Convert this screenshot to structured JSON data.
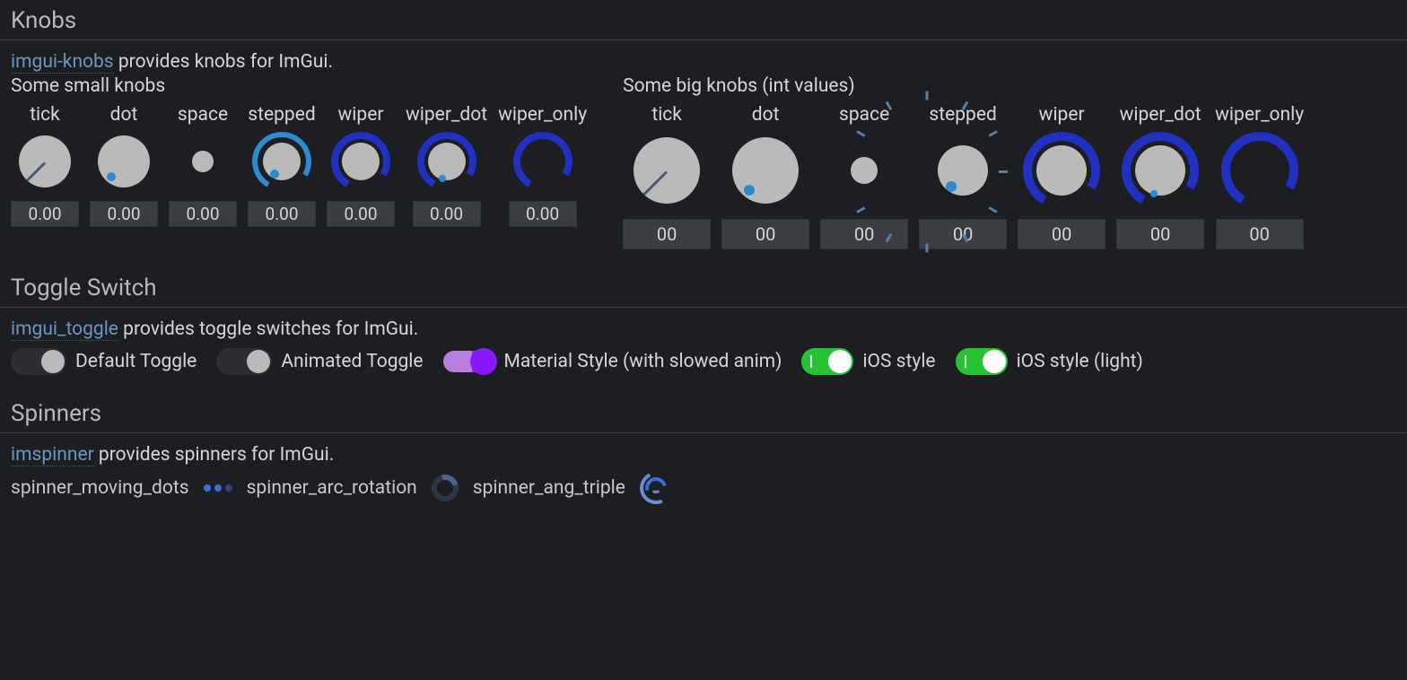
{
  "sections": {
    "knobs": {
      "title": "Knobs",
      "link_text": "imgui-knobs",
      "desc_rest": " provides knobs for ImGui.",
      "small_heading": "Some small knobs",
      "big_heading": "Some big knobs (int values)",
      "small": [
        {
          "label": "tick",
          "value": "0.00",
          "type": "tick"
        },
        {
          "label": "dot",
          "value": "0.00",
          "type": "dot"
        },
        {
          "label": "space",
          "value": "0.00",
          "type": "space"
        },
        {
          "label": "stepped",
          "value": "0.00",
          "type": "stepped"
        },
        {
          "label": "wiper",
          "value": "0.00",
          "type": "wiper"
        },
        {
          "label": "wiper_dot",
          "value": "0.00",
          "type": "wiper_dot"
        },
        {
          "label": "wiper_only",
          "value": "0.00",
          "type": "wiper_only"
        }
      ],
      "big": [
        {
          "label": "tick",
          "value": "00",
          "type": "tick"
        },
        {
          "label": "dot",
          "value": "00",
          "type": "dot"
        },
        {
          "label": "space",
          "value": "00",
          "type": "space"
        },
        {
          "label": "stepped",
          "value": "00",
          "type": "stepped_big"
        },
        {
          "label": "wiper",
          "value": "00",
          "type": "wiper"
        },
        {
          "label": "wiper_dot",
          "value": "00",
          "type": "wiper_dot"
        },
        {
          "label": "wiper_only",
          "value": "00",
          "type": "wiper_only"
        }
      ]
    },
    "toggle": {
      "title": "Toggle Switch",
      "link_text": "imgui_toggle",
      "desc_rest": " provides toggle switches for ImGui.",
      "items": [
        {
          "label": "Default Toggle",
          "style": "default"
        },
        {
          "label": "Animated Toggle",
          "style": "default"
        },
        {
          "label": "Material Style (with slowed anim)",
          "style": "material"
        },
        {
          "label": "iOS style",
          "style": "ios"
        },
        {
          "label": "iOS style (light)",
          "style": "ios"
        }
      ]
    },
    "spinners": {
      "title": "Spinners",
      "link_text": "imspinner",
      "desc_rest": " provides spinners for ImGui.",
      "items": [
        {
          "label": "spinner_moving_dots",
          "icon": "dots"
        },
        {
          "label": "spinner_arc_rotation",
          "icon": "arc"
        },
        {
          "label": "spinner_ang_triple",
          "icon": "triple"
        }
      ]
    }
  }
}
